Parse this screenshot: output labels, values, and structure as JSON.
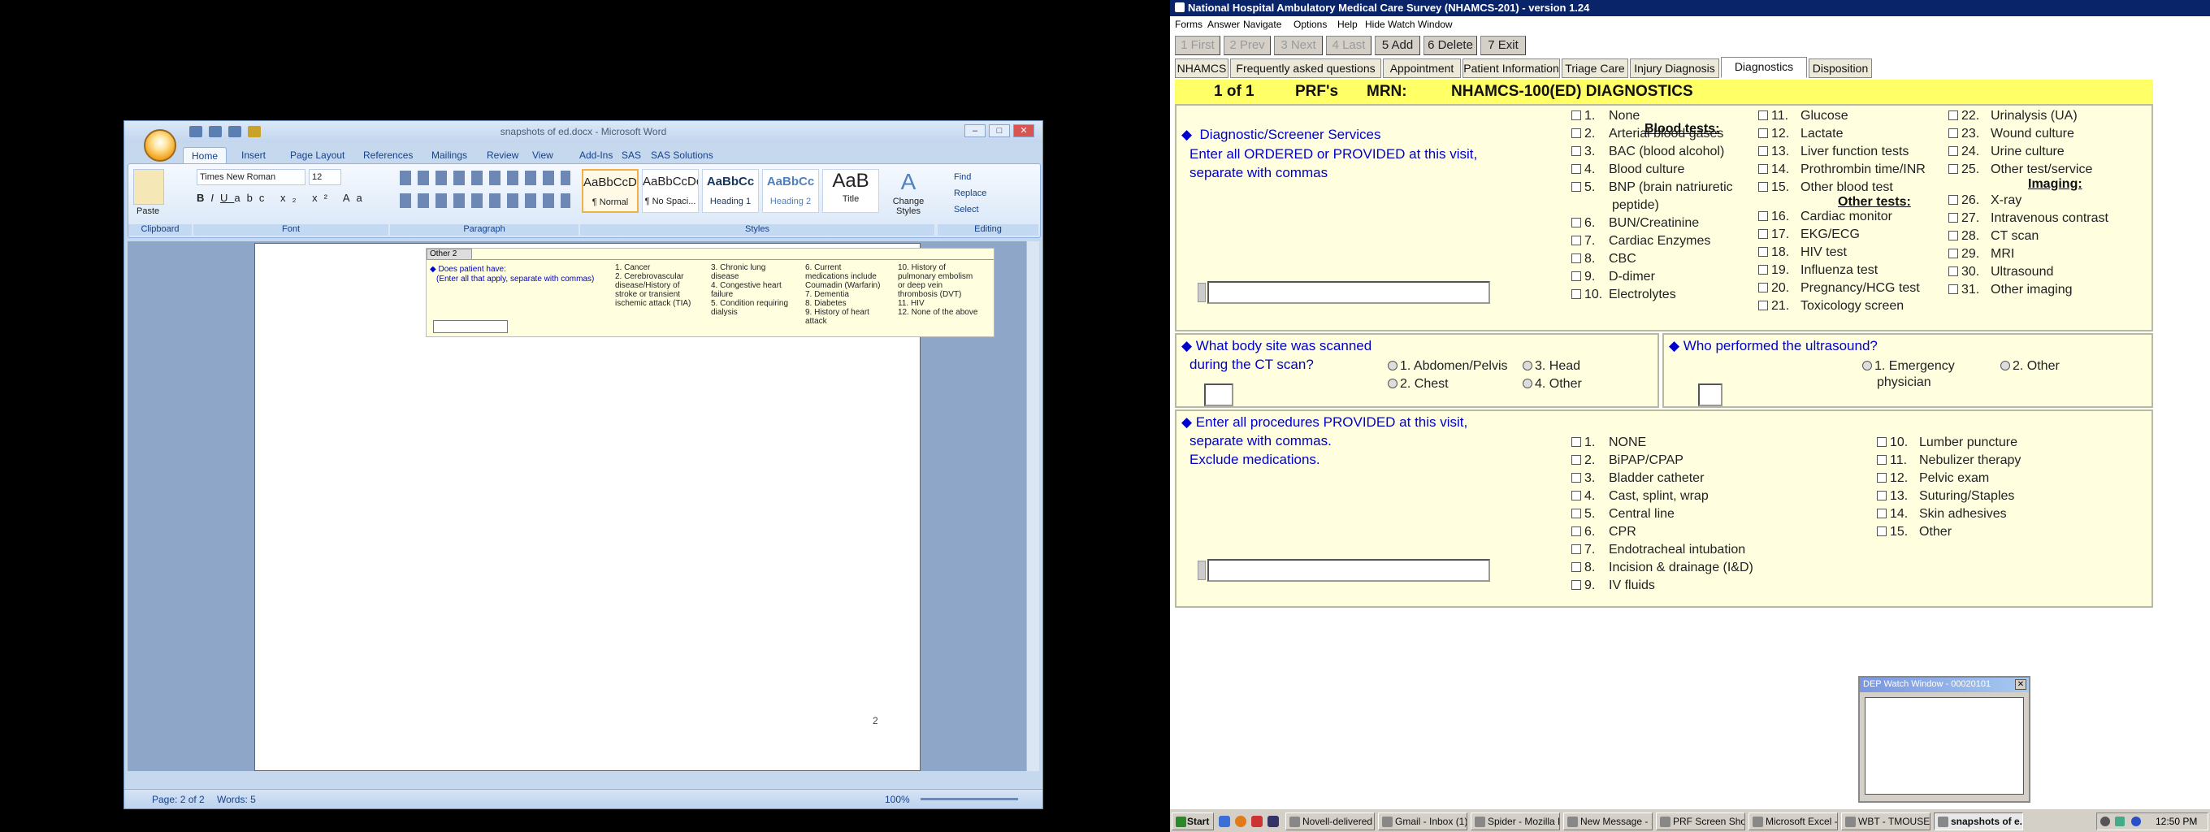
{
  "word": {
    "title": "snapshots of ed.docx - Microsoft Word",
    "tabs": [
      "Home",
      "Insert",
      "Page Layout",
      "References",
      "Mailings",
      "Review",
      "View",
      "Add-Ins",
      "SAS",
      "SAS Solutions"
    ],
    "font_name": "Times New Roman",
    "font_size": "12",
    "groups": {
      "clipboard": "Clipboard",
      "font": "Font",
      "paragraph": "Paragraph",
      "styles": "Styles",
      "editing": "Editing"
    },
    "paste_label": "Paste",
    "styles": [
      {
        "preview": "AaBbCcDc",
        "name": "¶ Normal"
      },
      {
        "preview": "AaBbCcDc",
        "name": "¶ No Spaci..."
      },
      {
        "preview": "AaBbCc",
        "name": "Heading 1"
      },
      {
        "preview": "AaBbCc",
        "name": "Heading 2"
      },
      {
        "preview": "AaB",
        "name": "Title"
      }
    ],
    "change_styles": "Change Styles",
    "editing": {
      "find": "Find",
      "replace": "Replace",
      "select": "Select"
    },
    "doc_mini": {
      "tab_label": "Other 2",
      "question": "Does patient have:",
      "instruction": "(Enter all that apply, separate with commas)",
      "options": [
        "1. Cancer",
        "2. Cerebrovascular disease/History of stroke or transient ischemic attack (TIA)",
        "3. Chronic lung disease",
        "4. Congestive heart failure",
        "5. Condition requiring dialysis",
        "6. Current medications include Coumadin (Warfarin)",
        "7. Dementia",
        "8. Diabetes",
        "9. History of heart attack",
        "10. History of pulmonary embolism or deep vein thrombosis (DVT)",
        "11. HIV",
        "12. None of the above"
      ]
    },
    "page_number": "2",
    "status": {
      "page": "Page: 2 of 2",
      "words": "Words: 5",
      "zoom": "100%"
    }
  },
  "app": {
    "title": "National Hospital Ambulatory Medical Care Survey (NHAMCS-201) - version 1.24",
    "menu": [
      "Forms",
      "Answer",
      "Navigate",
      "Options",
      "Help",
      "Hide Watch Window"
    ],
    "nav_buttons": [
      {
        "label": "1 First",
        "enabled": false
      },
      {
        "label": "2 Prev",
        "enabled": false
      },
      {
        "label": "3 Next",
        "enabled": false
      },
      {
        "label": "4 Last",
        "enabled": false
      },
      {
        "label": "5 Add",
        "enabled": true
      },
      {
        "label": "6 Delete",
        "enabled": true
      },
      {
        "label": "7 Exit",
        "enabled": true
      }
    ],
    "tabs": [
      "NHAMCS",
      "Frequently asked questions",
      "Appointment",
      "Patient Information",
      "Triage Care",
      "Injury Diagnosis",
      "Diagnostics",
      "Disposition"
    ],
    "active_tab": "Diagnostics",
    "header": {
      "record": "1 of 1",
      "form": "PRF's",
      "mrn_label": "MRN:",
      "mrn_value": "NHAMCS-100(ED) DIAGNOSTICS"
    },
    "diagnostic": {
      "question": "Diagnostic/Screener Services",
      "instruction_1": "Enter all ORDERED or PROVIDED at this visit,",
      "instruction_2": "separate with commas",
      "col1": [
        {
          "n": "1.",
          "label": "None"
        },
        {
          "n": "2.",
          "label": "Arterial blood gases"
        },
        {
          "n": "3.",
          "label": "BAC (blood alcohol)"
        },
        {
          "n": "4.",
          "label": "Blood culture"
        },
        {
          "n": "5.",
          "label": "BNP (brain natriuretic",
          "label2": "peptide)"
        },
        {
          "n": "6.",
          "label": "BUN/Creatinine"
        },
        {
          "n": "7.",
          "label": "Cardiac Enzymes"
        },
        {
          "n": "8.",
          "label": "CBC"
        },
        {
          "n": "9.",
          "label": "D-dimer"
        },
        {
          "n": "10.",
          "label": "Electrolytes"
        }
      ],
      "header_blood": "Blood tests:",
      "col2": [
        {
          "n": "11.",
          "label": "Glucose"
        },
        {
          "n": "12.",
          "label": "Lactate"
        },
        {
          "n": "13.",
          "label": "Liver function tests"
        },
        {
          "n": "14.",
          "label": "Prothrombin time/INR"
        },
        {
          "n": "15.",
          "label": "Other blood test"
        }
      ],
      "header_other": "Other tests:",
      "col2b": [
        {
          "n": "16.",
          "label": "Cardiac monitor"
        },
        {
          "n": "17.",
          "label": "EKG/ECG"
        },
        {
          "n": "18.",
          "label": "HIV test"
        },
        {
          "n": "19.",
          "label": "Influenza test"
        },
        {
          "n": "20.",
          "label": "Pregnancy/HCG test"
        },
        {
          "n": "21.",
          "label": "Toxicology screen"
        }
      ],
      "col3": [
        {
          "n": "22.",
          "label": "Urinalysis (UA)"
        },
        {
          "n": "23.",
          "label": "Wound culture"
        },
        {
          "n": "24.",
          "label": "Urine culture"
        },
        {
          "n": "25.",
          "label": "Other test/service"
        }
      ],
      "header_imaging": "Imaging:",
      "col3b": [
        {
          "n": "26.",
          "label": "X-ray"
        },
        {
          "n": "27.",
          "label": "Intravenous contrast"
        },
        {
          "n": "28.",
          "label": "CT scan"
        },
        {
          "n": "29.",
          "label": "MRI"
        },
        {
          "n": "30.",
          "label": "Ultrasound"
        },
        {
          "n": "31.",
          "label": "Other imaging"
        }
      ]
    },
    "ct": {
      "question_1": "What body site was scanned",
      "question_2": "during the CT scan?",
      "options": [
        "1. Abdomen/Pelvis",
        "2. Chest",
        "3. Head",
        "4. Other"
      ]
    },
    "us": {
      "question": "Who performed the ultrasound?",
      "options": [
        "1. Emergency",
        "physician",
        "2. Other"
      ]
    },
    "procedures": {
      "question_1": "Enter all procedures PROVIDED at this visit,",
      "question_2": "separate with commas.",
      "question_3": "Exclude medications.",
      "col1": [
        {
          "n": "1.",
          "label": "NONE"
        },
        {
          "n": "2.",
          "label": "BiPAP/CPAP"
        },
        {
          "n": "3.",
          "label": "Bladder catheter"
        },
        {
          "n": "4.",
          "label": "Cast, splint, wrap"
        },
        {
          "n": "5.",
          "label": "Central line"
        },
        {
          "n": "6.",
          "label": "CPR"
        },
        {
          "n": "7.",
          "label": "Endotracheal intubation"
        },
        {
          "n": "8.",
          "label": "Incision & drainage (I&D)"
        },
        {
          "n": "9.",
          "label": "IV fluids"
        }
      ],
      "col2": [
        {
          "n": "10.",
          "label": "Lumber puncture"
        },
        {
          "n": "11.",
          "label": "Nebulizer therapy"
        },
        {
          "n": "12.",
          "label": "Pelvic exam"
        },
        {
          "n": "13.",
          "label": "Suturing/Staples"
        },
        {
          "n": "14.",
          "label": "Skin adhesives"
        },
        {
          "n": "15.",
          "label": "Other"
        }
      ]
    },
    "watch": {
      "title": "DEP Watch Window - 00020101"
    }
  },
  "taskbar": {
    "start": "Start",
    "items": [
      "Novell-delivered ...",
      "Gmail - Inbox (1)...",
      "Spider - Mozilla Fi...",
      "New Message - ...",
      "PRF Screen Shots",
      "Microsoft Excel - ...",
      "WBT - TMOUSER...",
      "snapshots of e..."
    ],
    "active_index": 7,
    "clock": "12:50 PM"
  }
}
